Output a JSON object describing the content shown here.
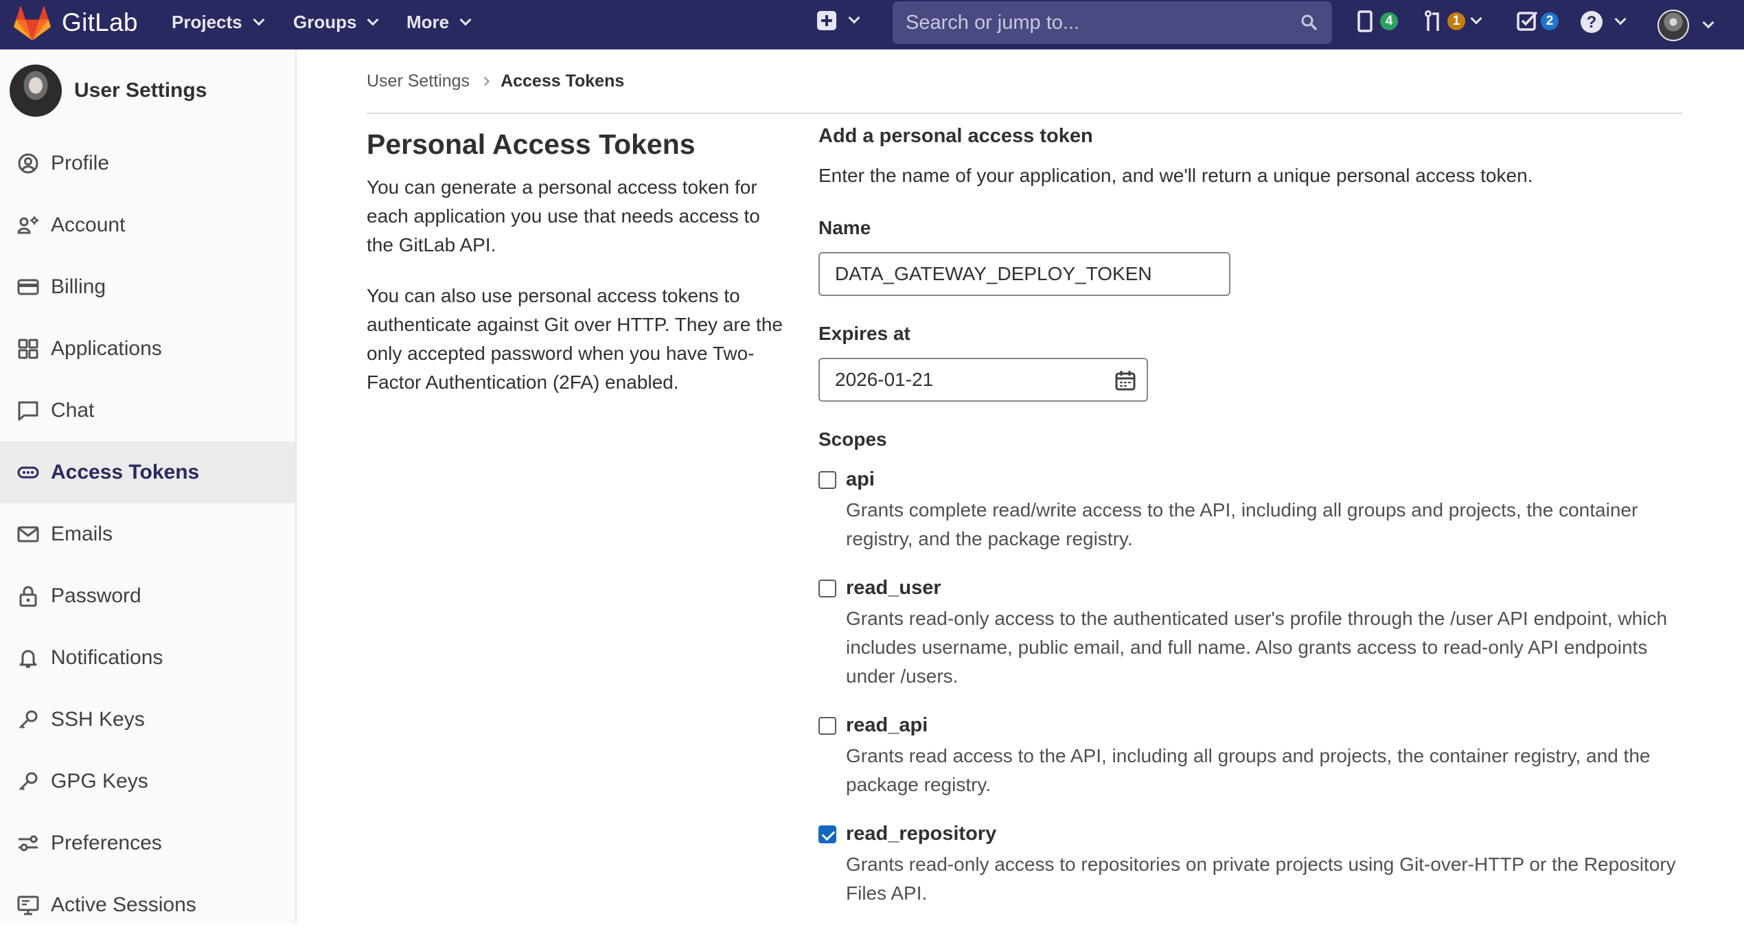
{
  "navbar": {
    "brand": "GitLab",
    "menus": [
      {
        "label": "Projects"
      },
      {
        "label": "Groups"
      },
      {
        "label": "More"
      }
    ],
    "search_placeholder": "Search or jump to...",
    "issues_count": "4",
    "merge_requests_count": "1",
    "todos_count": "2",
    "colors": {
      "background": "#292961",
      "issues_badge": "#2da160",
      "mr_badge": "#c17d10",
      "todos_badge": "#1f75cb"
    }
  },
  "sidebar": {
    "title": "User Settings",
    "items": [
      {
        "label": "Profile",
        "icon": "profile-icon"
      },
      {
        "label": "Account",
        "icon": "account-icon"
      },
      {
        "label": "Billing",
        "icon": "billing-icon"
      },
      {
        "label": "Applications",
        "icon": "applications-icon"
      },
      {
        "label": "Chat",
        "icon": "chat-icon"
      },
      {
        "label": "Access Tokens",
        "icon": "token-icon",
        "active": true
      },
      {
        "label": "Emails",
        "icon": "mail-icon"
      },
      {
        "label": "Password",
        "icon": "lock-icon"
      },
      {
        "label": "Notifications",
        "icon": "bell-icon"
      },
      {
        "label": "SSH Keys",
        "icon": "key-icon"
      },
      {
        "label": "GPG Keys",
        "icon": "key-icon"
      },
      {
        "label": "Preferences",
        "icon": "preferences-icon"
      },
      {
        "label": "Active Sessions",
        "icon": "monitor-icon"
      }
    ]
  },
  "breadcrumb": {
    "parent": "User Settings",
    "current": "Access Tokens"
  },
  "intro": {
    "title": "Personal Access Tokens",
    "paragraph1": "You can generate a personal access token for each application you use that needs access to the GitLab API.",
    "paragraph2": "You can also use personal access tokens to authenticate against Git over HTTP. They are the only accepted password when you have Two-Factor Authentication (2FA) enabled."
  },
  "form": {
    "heading": "Add a personal access token",
    "subheading": "Enter the name of your application, and we'll return a unique personal access token.",
    "name_label": "Name",
    "name_value": "DATA_GATEWAY_DEPLOY_TOKEN",
    "expires_label": "Expires at",
    "expires_value": "2026-01-21",
    "scopes_label": "Scopes",
    "scopes": [
      {
        "name": "api",
        "checked": false,
        "description": "Grants complete read/write access to the API, including all groups and projects, the container registry, and the package registry."
      },
      {
        "name": "read_user",
        "checked": false,
        "description": "Grants read-only access to the authenticated user's profile through the /user API endpoint, which includes username, public email, and full name. Also grants access to read-only API endpoints under /users."
      },
      {
        "name": "read_api",
        "checked": false,
        "description": "Grants read access to the API, including all groups and projects, the container registry, and the package registry."
      },
      {
        "name": "read_repository",
        "checked": true,
        "description": "Grants read-only access to repositories on private projects using Git-over-HTTP or the Repository Files API."
      }
    ],
    "colors": {
      "checkbox_checked": "#1068bf"
    }
  }
}
